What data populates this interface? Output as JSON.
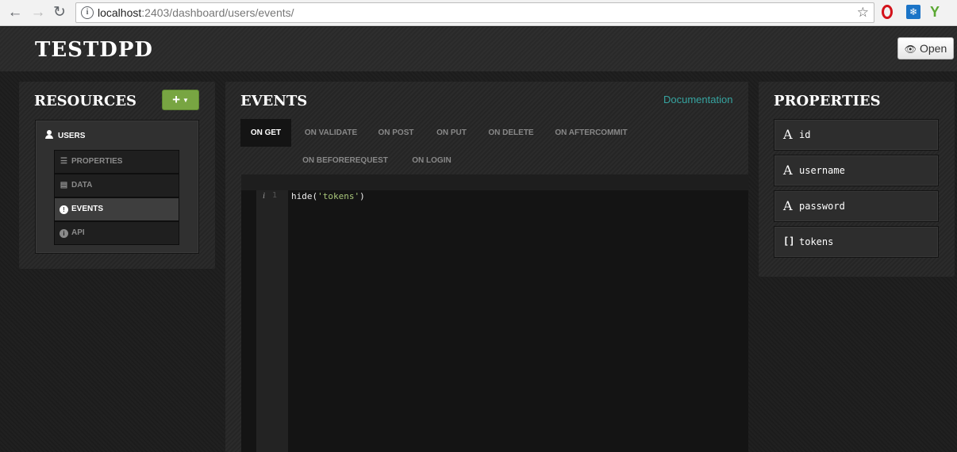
{
  "browser": {
    "url_host": "localhost",
    "url_path": ":2403/dashboard/users/events/"
  },
  "header": {
    "app_title": "TESTDPD",
    "open_label": "Open"
  },
  "resources": {
    "title": "RESOURCES",
    "add_label": "+",
    "resource_name": "USERS",
    "items": [
      {
        "label": "PROPERTIES",
        "icon": "list-icon"
      },
      {
        "label": "DATA",
        "icon": "table-icon"
      },
      {
        "label": "EVENTS",
        "icon": "exclamation-icon",
        "active": true
      },
      {
        "label": "API",
        "icon": "info-icon"
      }
    ]
  },
  "events": {
    "title": "EVENTS",
    "documentation_label": "Documentation",
    "tabs": [
      {
        "label": "ON GET",
        "active": true
      },
      {
        "label": "ON VALIDATE"
      },
      {
        "label": "ON POST"
      },
      {
        "label": "ON PUT"
      },
      {
        "label": "ON DELETE"
      },
      {
        "label": "ON AFTERCOMMIT"
      },
      {
        "label": "ON BEFOREREQUEST"
      },
      {
        "label": "ON LOGIN"
      }
    ],
    "editor": {
      "gutter_marker": "i",
      "line_number": "1",
      "code_fn": "hide(",
      "code_str": "'tokens'",
      "code_end": ")"
    }
  },
  "properties": {
    "title": "PROPERTIES",
    "items": [
      {
        "type_glyph": "A",
        "name": "id"
      },
      {
        "type_glyph": "A",
        "name": "username"
      },
      {
        "type_glyph": "A",
        "name": "password"
      },
      {
        "type_glyph": "[]",
        "name": "tokens"
      }
    ]
  },
  "colors": {
    "accent_green": "#78a542",
    "link_teal": "#36a4a0",
    "string_green": "#a8c67a"
  }
}
